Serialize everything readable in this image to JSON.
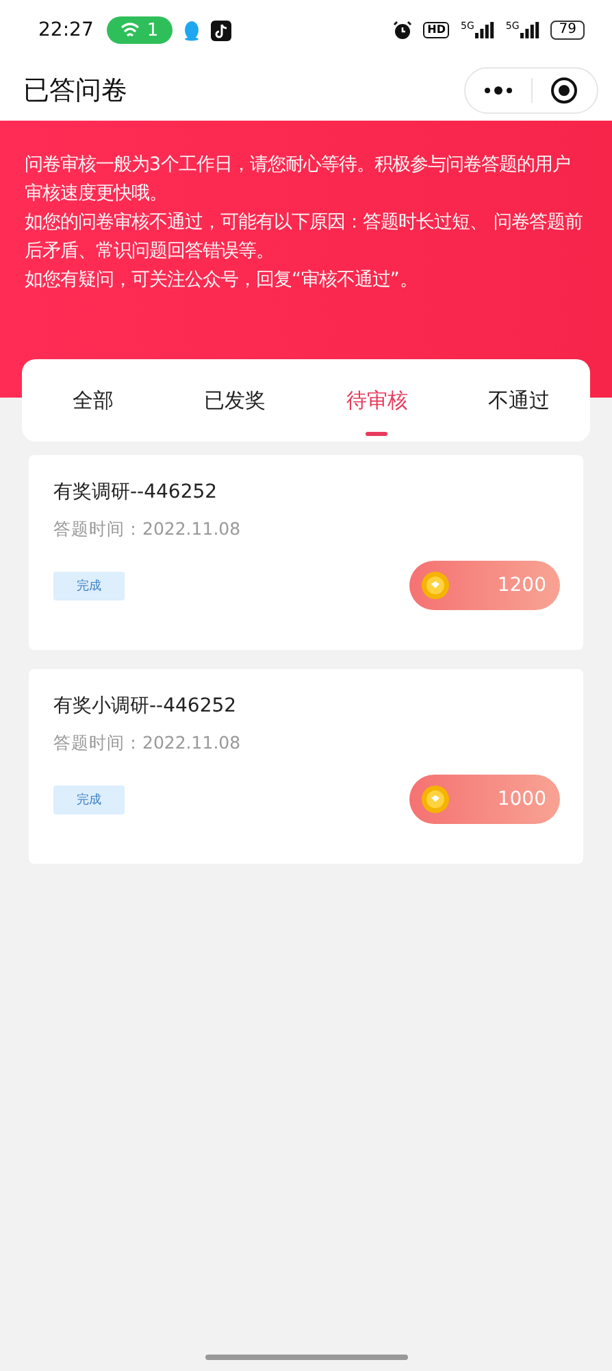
{
  "status_bar": {
    "time": "22:27",
    "wifi_count": "1",
    "hd": "HD",
    "networks": [
      "5G",
      "5G"
    ],
    "battery": "79"
  },
  "header": {
    "title": "已答问卷"
  },
  "notice": [
    "问卷审核一般为3个工作日，请您耐心等待。积极参与问卷答题的用户审核速度更快哦。",
    "如您的问卷审核不通过，可能有以下原因：答题时长过短、 问卷答题前后矛盾、常识问题回答错误等。",
    "如您有疑问，可关注公众号，回复“审核不通过”。"
  ],
  "tabs": [
    {
      "label": "全部",
      "selected": false
    },
    {
      "label": "已发奖",
      "selected": false
    },
    {
      "label": "待审核",
      "selected": true
    },
    {
      "label": "不通过",
      "selected": false
    }
  ],
  "surveys": [
    {
      "title": "有奖调研--446252",
      "time": "答题时间：2022.11.08",
      "status": "完成",
      "reward": "1200"
    },
    {
      "title": "有奖小调研--446252",
      "time": "答题时间：2022.11.08",
      "status": "完成",
      "reward": "1000"
    }
  ]
}
